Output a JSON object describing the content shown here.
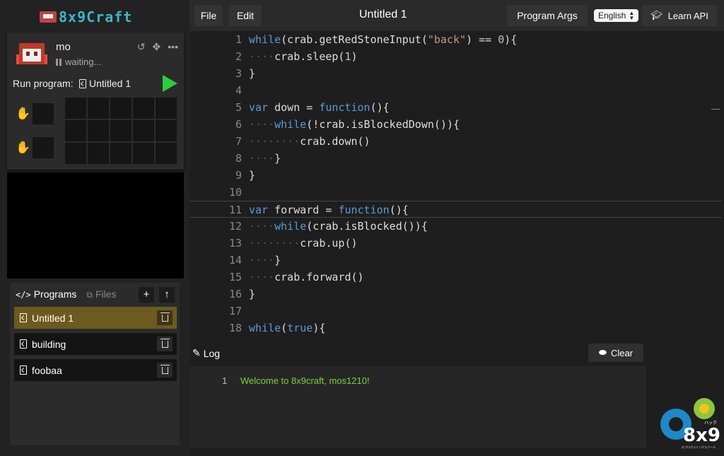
{
  "brand": {
    "text": "8x9Craft",
    "color": "#3db6c7"
  },
  "robot": {
    "name": "mo",
    "status": "waiting...",
    "run_label": "Run program:",
    "run_program": "Untitled 1",
    "tool_icons": [
      "undo-icon",
      "move-icon",
      "more-icon"
    ],
    "run_color": "#2ecc40"
  },
  "programs": {
    "tab_programs": "Programs",
    "tab_files": "Files",
    "add_label": "+",
    "upload_label": "↑",
    "items": [
      {
        "label": "Untitled 1",
        "active": true
      },
      {
        "label": "building",
        "active": false
      },
      {
        "label": "foobaa",
        "active": false
      }
    ],
    "active_color": "#6c5a1f"
  },
  "topbar": {
    "file_label": "File",
    "edit_label": "Edit",
    "title": "Untitled 1",
    "args_label": "Program Args",
    "language": "English",
    "learn_label": "Learn API"
  },
  "editor": {
    "lines": [
      "1",
      "2",
      "3",
      "4",
      "5",
      "6",
      "7",
      "8",
      "9",
      "10",
      "11",
      "12",
      "13",
      "14",
      "15",
      "16",
      "17",
      "18"
    ],
    "code": [
      "while(crab.getRedStoneInput(\"back\") == 0){",
      "    crab.sleep(1)",
      "}",
      "",
      "var down = function(){",
      "    while(!crab.isBlockedDown()){",
      "        crab.down()",
      "    }",
      "}",
      "",
      "var forward = function(){",
      "    while(crab.isBlocked()){",
      "        crab.up()",
      "    }",
      "    crab.forward()",
      "}",
      "",
      "while(true){"
    ],
    "current_line": 11
  },
  "log": {
    "title": "Log",
    "clear_label": "Clear",
    "entries": [
      {
        "num": "1",
        "text": "Welcome to 8x9craft, mos1210!"
      }
    ],
    "text_color": "#7bd13a"
  },
  "logo": {
    "text": "8x9",
    "ruby": "ハック",
    "tagline": "のプログラミングスクール"
  }
}
